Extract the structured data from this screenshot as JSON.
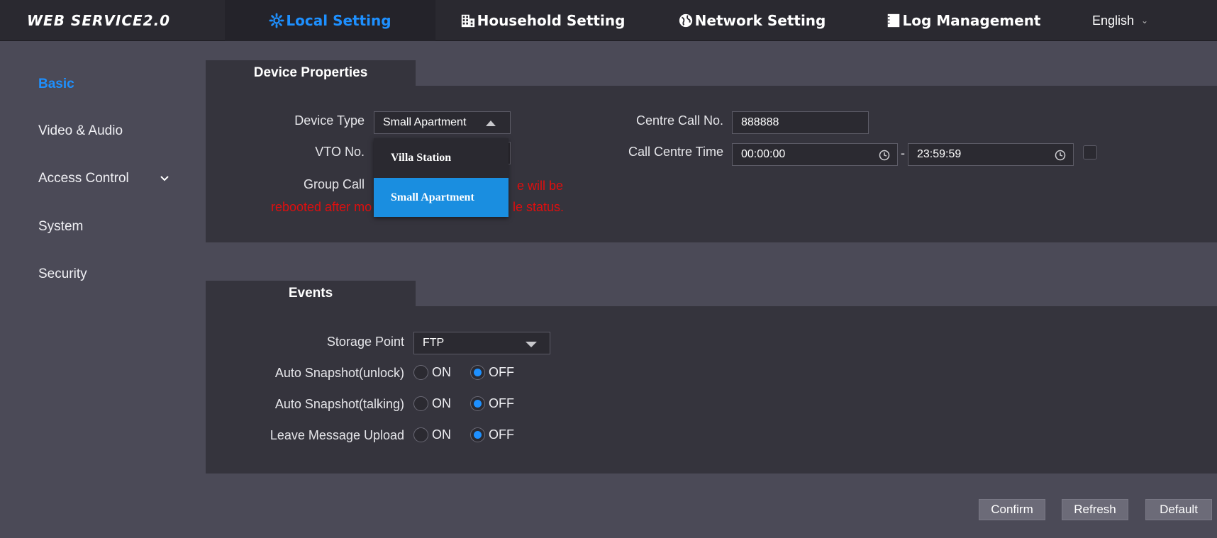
{
  "header": {
    "logo": "WEB SERVICE2.0",
    "nav": [
      {
        "label": "Local Setting",
        "icon": "gear-icon",
        "active": true
      },
      {
        "label": "Household Setting",
        "icon": "building-icon",
        "active": false
      },
      {
        "label": "Network Setting",
        "icon": "globe-icon",
        "active": false
      },
      {
        "label": "Log Management",
        "icon": "document-icon",
        "active": false
      }
    ],
    "language": "English"
  },
  "sidebar": {
    "items": [
      {
        "label": "Basic",
        "active": true
      },
      {
        "label": "Video & Audio",
        "active": false
      },
      {
        "label": "Access Control",
        "active": false,
        "expandable": true
      },
      {
        "label": "System",
        "active": false
      },
      {
        "label": "Security",
        "active": false
      }
    ]
  },
  "device_properties": {
    "title": "Device Properties",
    "device_type_label": "Device Type",
    "device_type_value": "Small Apartment",
    "device_type_options": [
      "Villa Station",
      "Small Apartment"
    ],
    "vto_label": "VTO No.",
    "group_call_label": "Group Call",
    "warning_line1": "e will be",
    "warning_line2_left": "rebooted after mo",
    "warning_line2_right": "le status.",
    "centre_call_label": "Centre Call No.",
    "centre_call_value": "888888",
    "call_centre_time_label": "Call Centre Time",
    "time_start": "00:00:00",
    "time_separator": "-",
    "time_end": "23:59:59"
  },
  "events": {
    "title": "Events",
    "storage_point_label": "Storage Point",
    "storage_point_value": "FTP",
    "on_label": "ON",
    "off_label": "OFF",
    "rows": [
      {
        "label": "Auto Snapshot(unlock)",
        "value": "OFF"
      },
      {
        "label": "Auto Snapshot(talking)",
        "value": "OFF"
      },
      {
        "label": "Leave Message Upload",
        "value": "OFF"
      }
    ]
  },
  "actions": {
    "confirm": "Confirm",
    "refresh": "Refresh",
    "default": "Default"
  },
  "colors": {
    "accent": "#1e90ff",
    "warning": "#e00e0e",
    "background": "#4b4a57",
    "panel": "#35343d"
  }
}
